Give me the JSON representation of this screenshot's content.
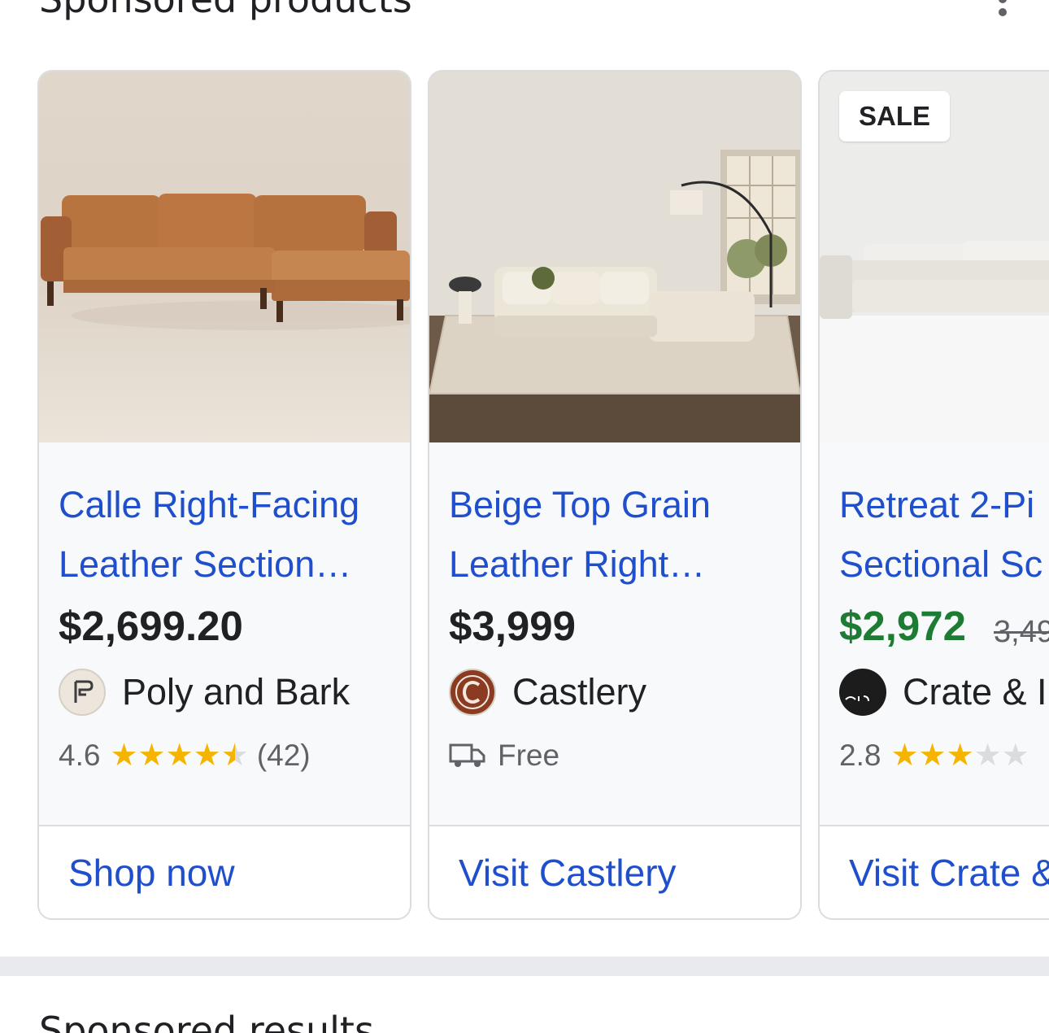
{
  "section": {
    "title": "Sponsored products",
    "menu_icon": "more-vert-icon"
  },
  "products": [
    {
      "title_line1": "Calle Right-Facing",
      "title_line2": "Leather Section…",
      "price": "$2,699.20",
      "merchant": "Poly and Bark",
      "rating": "4.6",
      "rating_value": 4.6,
      "review_count": "(42)",
      "cta": "Shop now"
    },
    {
      "title_line1": "Beige Top Grain",
      "title_line2": "Leather Right…",
      "price": "$3,999",
      "merchant": "Castlery",
      "shipping": "Free",
      "cta": "Visit Castlery"
    },
    {
      "badge": "SALE",
      "title_line1": "Retreat 2-Pi",
      "title_line2": "Sectional Sc",
      "price": "$2,972",
      "original_price": "3,49",
      "merchant": "Crate & I",
      "rating": "2.8",
      "rating_value": 2.8,
      "cta": "Visit Crate &"
    }
  ],
  "colors": {
    "link": "#1f4fcc",
    "sale_price": "#1e7b34",
    "star": "#f5b400"
  },
  "next_section": {
    "title": "Sponsored results"
  }
}
